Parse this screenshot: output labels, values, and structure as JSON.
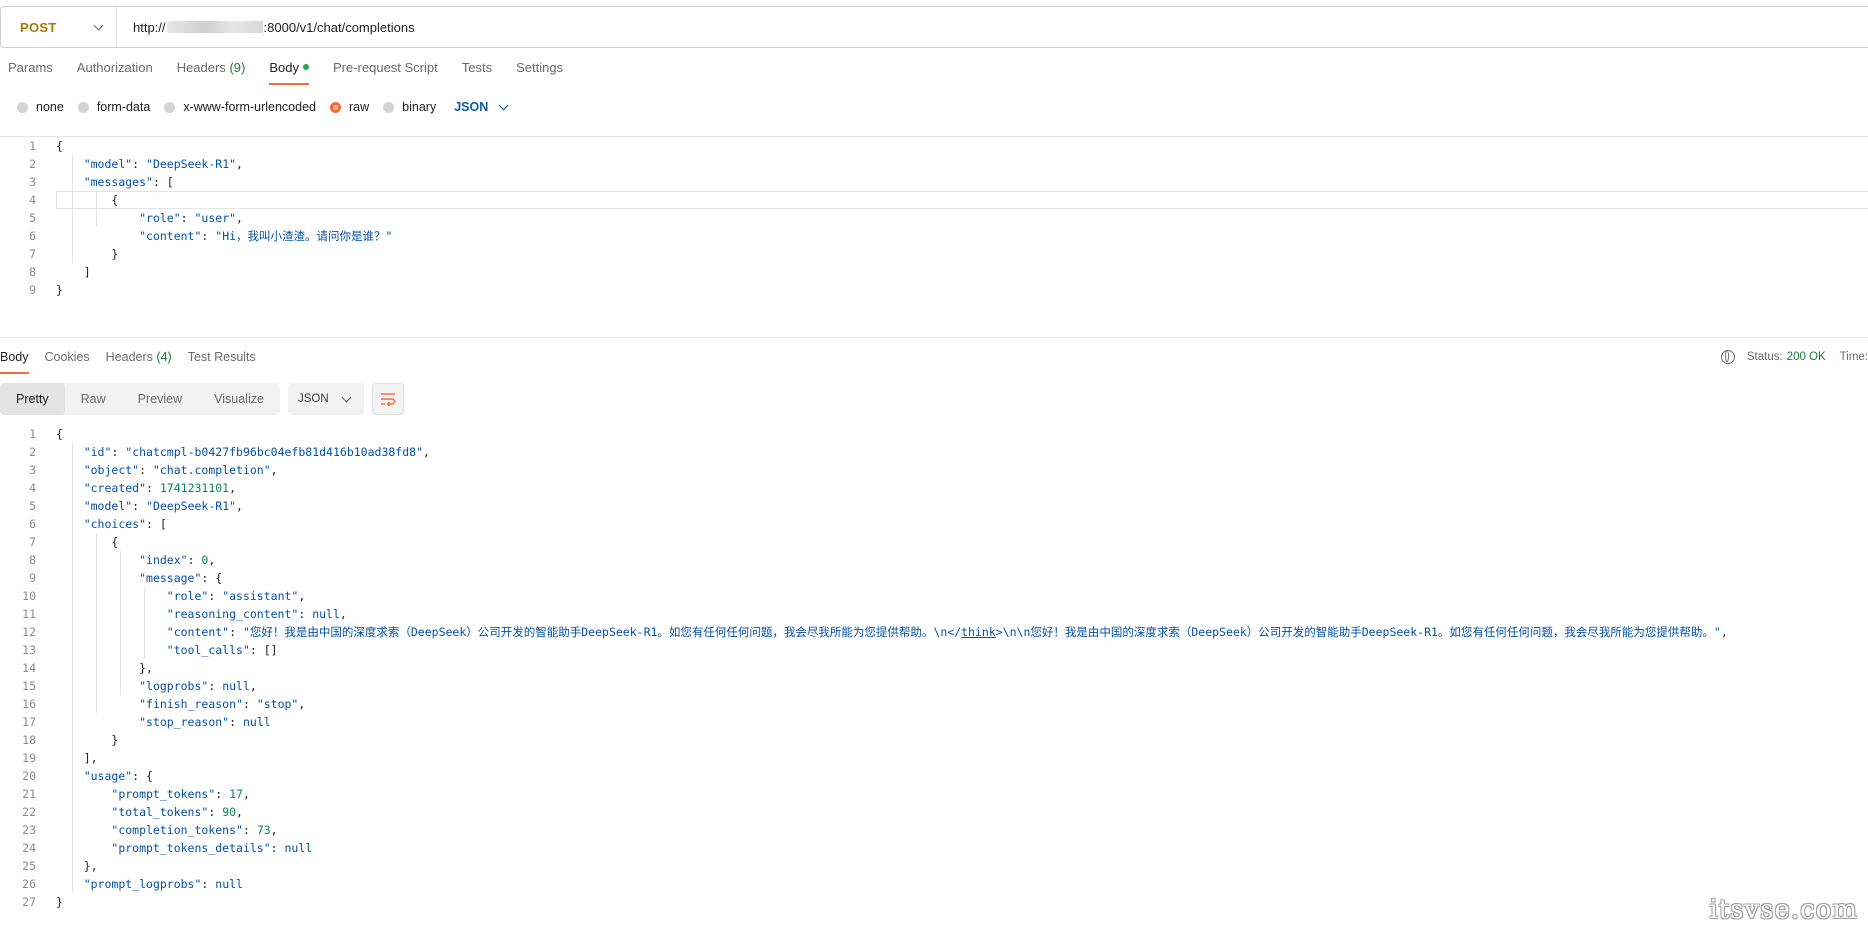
{
  "request": {
    "method": "POST",
    "url_prefix": "http://",
    "url_suffix": ":8000/v1/chat/completions",
    "tabs": [
      {
        "label": "Params",
        "count": ""
      },
      {
        "label": "Authorization",
        "count": ""
      },
      {
        "label": "Headers",
        "count": "(9)"
      },
      {
        "label": "Body",
        "count": ""
      },
      {
        "label": "Pre-request Script",
        "count": ""
      },
      {
        "label": "Tests",
        "count": ""
      },
      {
        "label": "Settings",
        "count": ""
      }
    ],
    "body_types": [
      "none",
      "form-data",
      "x-www-form-urlencoded",
      "raw",
      "binary"
    ],
    "body_format": "JSON"
  },
  "response": {
    "tabs": [
      {
        "label": "Body",
        "count": ""
      },
      {
        "label": "Cookies",
        "count": ""
      },
      {
        "label": "Headers",
        "count": "(4)"
      },
      {
        "label": "Test Results",
        "count": ""
      }
    ],
    "status_label": "Status:",
    "status_value": "200 OK",
    "time_label": "Time:",
    "views": [
      "Pretty",
      "Raw",
      "Preview",
      "Visualize"
    ],
    "format": "JSON"
  },
  "watermark": "itsvse.com",
  "colors": {
    "accent": "#f26b3a",
    "success": "#1a7f37",
    "method": "#a57b00",
    "json_key": "#0451a5",
    "json_number": "#098658"
  }
}
